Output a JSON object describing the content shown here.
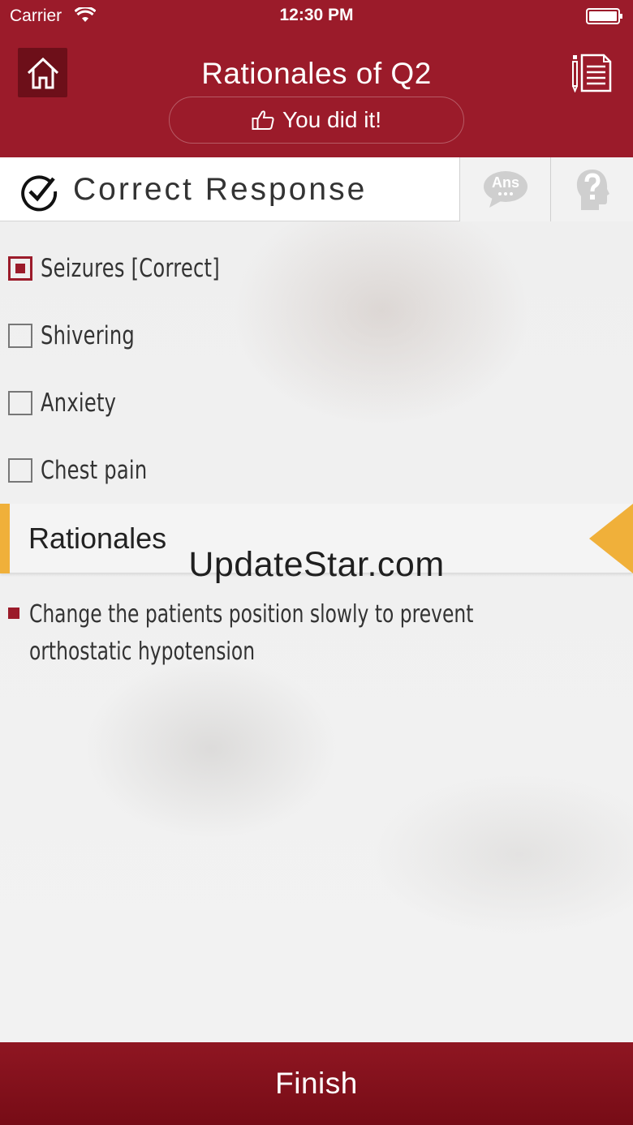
{
  "status_bar": {
    "carrier": "Carrier",
    "time": "12:30 PM",
    "icons": [
      "wifi-icon",
      "battery-icon"
    ]
  },
  "header": {
    "title": "Rationales of Q2",
    "feedback": "You did it!",
    "icons": [
      "home-icon",
      "notes-icon",
      "thumbs-up-icon"
    ]
  },
  "response_bar": {
    "title": "Correct Response",
    "answer_tab_label": "Ans",
    "icons": [
      "check-circle-icon",
      "answer-bubble-icon",
      "help-head-icon"
    ]
  },
  "options": [
    {
      "label": "Seizures [Correct]",
      "selected": true
    },
    {
      "label": "Shivering",
      "selected": false
    },
    {
      "label": "Anxiety",
      "selected": false
    },
    {
      "label": "Chest pain",
      "selected": false
    }
  ],
  "rationales": {
    "title": "Rationales",
    "items": [
      "Change the patients position slowly to prevent orthostatic hypotension"
    ]
  },
  "watermark": "UpdateStar.com",
  "footer": {
    "finish_label": "Finish"
  },
  "colors": {
    "primary": "#9b1b2a",
    "primary_dark": "#6d0f19",
    "accent": "#f0b03a"
  }
}
